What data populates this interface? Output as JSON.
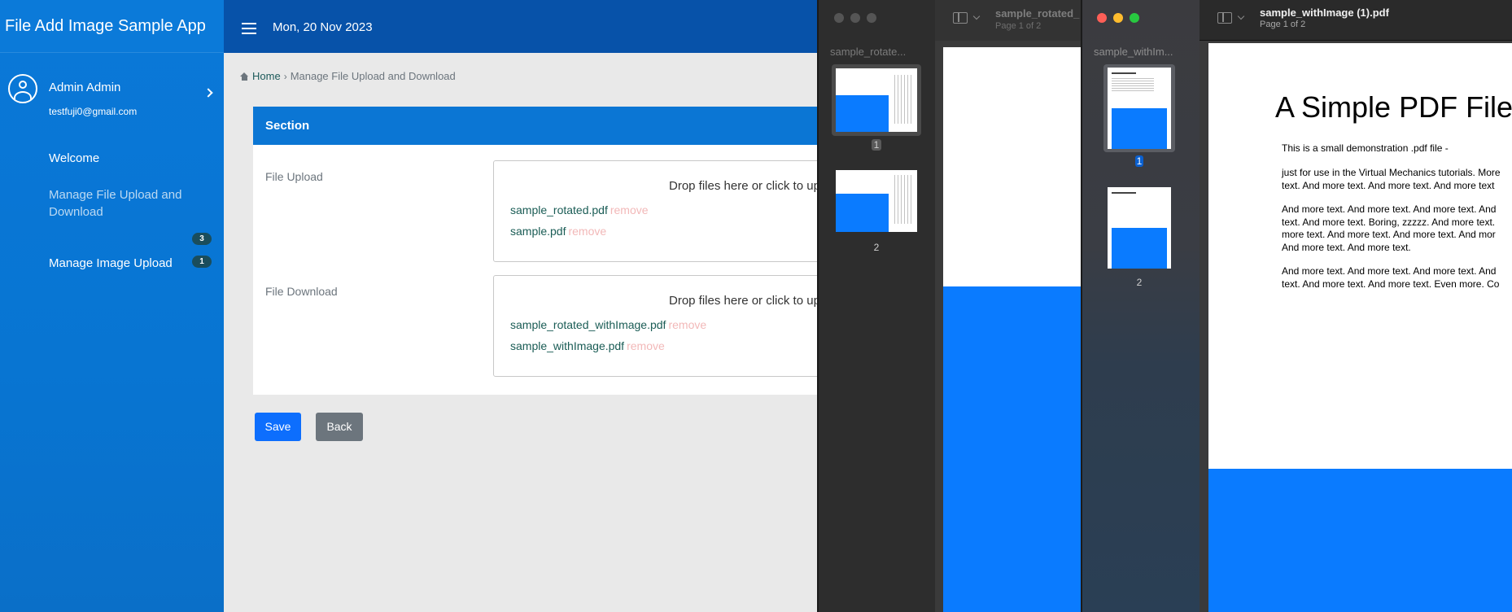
{
  "app": {
    "brand": "File Add Image Sample App"
  },
  "user": {
    "name": "Admin Admin",
    "email": "testfuji0@gmail.com"
  },
  "nav": {
    "items": [
      {
        "label": "Welcome"
      },
      {
        "label": "Manage File Upload and Download",
        "label_line1": "Manage File Upload and",
        "label_line2": "Download",
        "badge": "3",
        "active": true
      },
      {
        "label": "Manage Image Upload",
        "badge": "1"
      }
    ]
  },
  "topbar": {
    "date": "Mon, 20 Nov 2023"
  },
  "breadcrumb": {
    "home": "Home",
    "current": "Manage File Upload and Download"
  },
  "section": {
    "title": "Section",
    "upload": {
      "label": "File Upload",
      "drop_text": "Drop files here or click to upload",
      "files": [
        {
          "name": "sample_rotated.pdf"
        },
        {
          "name": "sample.pdf"
        }
      ]
    },
    "download": {
      "label": "File Download",
      "drop_text": "Drop files here or click to upload",
      "files": [
        {
          "name": "sample_rotated_withImage.pdf"
        },
        {
          "name": "sample_withImage.pdf"
        }
      ]
    },
    "remove_label": "remove"
  },
  "buttons": {
    "save": "Save",
    "back": "Back"
  },
  "preview_left": {
    "sidebar_title": "sample_rotate...",
    "title": "sample_rotated_",
    "subtitle": "Page 1 of 2",
    "pages": [
      "1",
      "2"
    ]
  },
  "preview_right": {
    "sidebar_title": "sample_withIm...",
    "title": "sample_withImage (1).pdf",
    "subtitle": "Page 1 of 2",
    "pages": [
      "1",
      "2"
    ],
    "doc": {
      "heading": "A Simple PDF File",
      "p1": "This is a small demonstration .pdf file -",
      "p2_l1": "just for use in the Virtual Mechanics tutorials. More",
      "p2_l2": "text. And more text. And more text. And more text",
      "p3_l1": "And more text. And more text. And more text. And",
      "p3_l2": "text. And more text. Boring, zzzzz. And more text.",
      "p3_l3": "more text. And more text. And more text. And mor",
      "p3_l4": "And more text. And more text.",
      "p4_l1": "And more text. And more text. And more text. And",
      "p4_l2": "text. And more text. And more text. Even more. Co"
    }
  },
  "colors": {
    "sidebar": "#0a78d8",
    "topbar": "#0752a9",
    "card_header": "#0b76d4",
    "save": "#0d6efd",
    "back": "#6c757d",
    "file_link": "#1a5c55",
    "remove_link": "#f2b8b8",
    "pdf_blue": "#0a7bff"
  }
}
